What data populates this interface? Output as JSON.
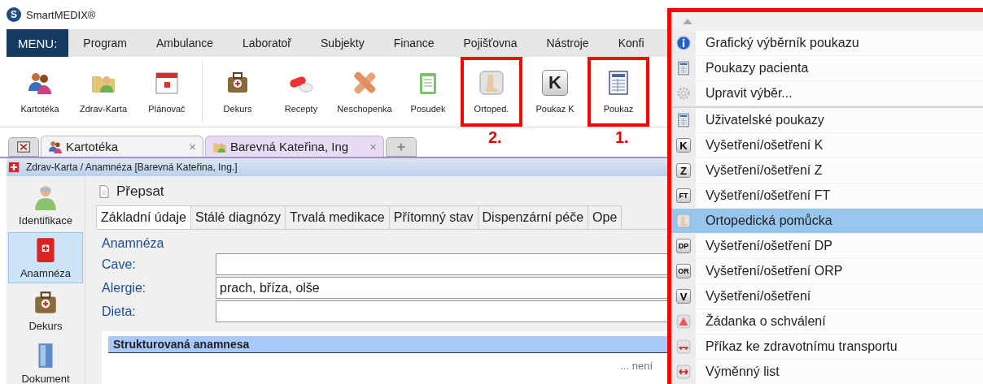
{
  "app": {
    "logo_letter": "S",
    "title": "SmartMEDIX®"
  },
  "menu_bar": {
    "label": "MENU:",
    "items": [
      "Program",
      "Ambulance",
      "Laboratoř",
      "Subjekty",
      "Finance",
      "Pojišťovna",
      "Nástroje",
      "Konfi"
    ]
  },
  "toolbar": [
    {
      "kind": "people",
      "label": "Kartotéka"
    },
    {
      "kind": "folder",
      "label": "Zdrav-Karta"
    },
    {
      "kind": "calendar",
      "label": "Plánovač",
      "separator_after": true
    },
    {
      "kind": "briefcase",
      "label": "Dekurs"
    },
    {
      "kind": "pills",
      "label": "Recepty"
    },
    {
      "kind": "bandage",
      "label": "Neschopenka"
    },
    {
      "kind": "clipboard",
      "label": "Posudek"
    },
    {
      "kind": "foot",
      "label": "Ortoped.",
      "annotation": "2."
    },
    {
      "kind": "letter",
      "letter": "K",
      "label": "Poukaz K"
    },
    {
      "kind": "form",
      "label": "Poukaz",
      "annotation": "1."
    }
  ],
  "doc_tabs": [
    {
      "kind": "close"
    },
    {
      "kind": "list-tab",
      "label": "Kartotéka",
      "close_glyph": "×",
      "selected": false
    },
    {
      "kind": "patient-tab",
      "label": "Barevná Kateřina, Ing",
      "close_glyph": "×",
      "selected": true
    },
    {
      "kind": "add"
    }
  ],
  "breadcrumb": "Zdrav-Karta / Anamnéza [Barevná Kateřina, Ing.]",
  "sidebar": [
    {
      "kind": "person",
      "label": "Identifikace",
      "selected": false
    },
    {
      "kind": "redbook",
      "label": "Anamnéza",
      "selected": true
    },
    {
      "kind": "briefcase",
      "label": "Dekurs",
      "selected": false
    },
    {
      "kind": "binder",
      "label": "Dokument",
      "selected": false
    }
  ],
  "action": "Přepsat",
  "form_tabs": [
    {
      "label": "Základní údaje",
      "selected": true
    },
    {
      "label": "Stálé diagnózy",
      "selected": false
    },
    {
      "label": "Trvalá medikace",
      "selected": false
    },
    {
      "label": "Přítomný stav",
      "selected": false
    },
    {
      "label": "Dispenzární péče",
      "selected": false
    },
    {
      "label": "Ope",
      "selected": false
    }
  ],
  "group": {
    "title": "Anamnéza",
    "fields": [
      {
        "label": "Cave:"
      },
      {
        "label": "Alergie:",
        "value": "prach, bříza, olše"
      },
      {
        "label": "Dieta:"
      }
    ]
  },
  "section": {
    "title": "Strukturovaná anamnesa",
    "note": "... není"
  },
  "dropdown": {
    "annotated": true,
    "items": [
      {
        "kind": "info",
        "label": "Grafický výběrník poukazu",
        "selected": false
      },
      {
        "kind": "form",
        "label": "Poukazy pacienta",
        "selected": false
      },
      {
        "kind": "gear",
        "label": "Upravit výběr...",
        "selected": false
      },
      {
        "kind": "form",
        "label": "Uživatelské poukazy",
        "selected": false,
        "separator_before": true
      },
      {
        "kind": "letter",
        "letter": "K",
        "label": "Vyšetření/ošetření K",
        "selected": false
      },
      {
        "kind": "letter",
        "letter": "Z",
        "label": "Vyšetření/ošetření Z",
        "selected": false
      },
      {
        "kind": "letter",
        "letter": "FT",
        "label": "Vyšetření/ošetření FT",
        "selected": false
      },
      {
        "kind": "foot",
        "label": "Ortopedická pomůcka",
        "selected": true
      },
      {
        "kind": "letter",
        "letter": "DP",
        "label": "Vyšetření/ošetření DP",
        "selected": false
      },
      {
        "kind": "letter",
        "letter": "OR",
        "label": "Vyšetření/ošetření ORP",
        "selected": false
      },
      {
        "kind": "letter",
        "letter": "V",
        "label": "Vyšetření/ošetření",
        "selected": false
      },
      {
        "kind": "triangle",
        "label": "Žádanka o schválení",
        "selected": false
      },
      {
        "kind": "transport",
        "label": "Příkaz ke zdravotnímu transportu",
        "selected": false
      },
      {
        "kind": "arrows",
        "label": "Výměnný list",
        "selected": false
      }
    ]
  }
}
